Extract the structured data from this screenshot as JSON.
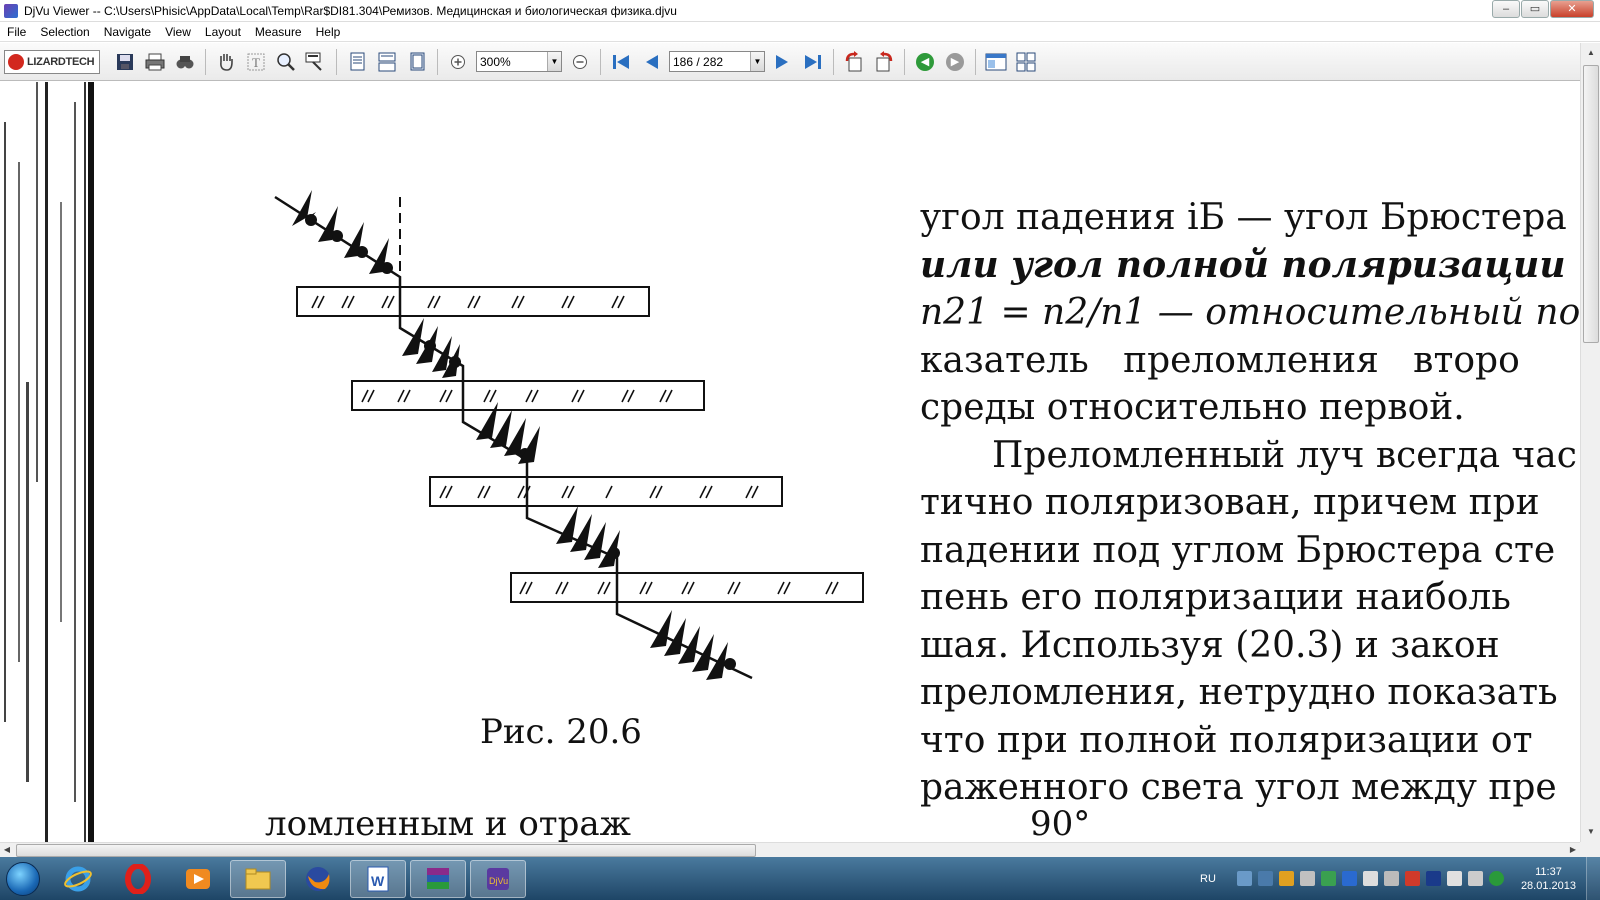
{
  "window": {
    "title": "DjVu Viewer -- C:\\Users\\Phisic\\AppData\\Local\\Temp\\Rar$DI81.304\\Ремизов. Медицинская и биологическая физика.djvu",
    "minimize": "–",
    "maximize": "▭",
    "close": "✕"
  },
  "menu": [
    "File",
    "Selection",
    "Navigate",
    "View",
    "Layout",
    "Measure",
    "Help"
  ],
  "toolbar": {
    "logo_text": "LIZARDTECH",
    "zoom_value": "300%",
    "page_value": "186 / 282",
    "icons": [
      "save-icon",
      "print-icon",
      "find-icon",
      "hand-icon",
      "text-select-icon",
      "zoom-icon",
      "marquee-zoom-icon",
      "single-page-icon",
      "continuous-icon",
      "facing-icon",
      "zoom-in-icon",
      "zoom-out-icon",
      "first-page-icon",
      "prev-page-icon",
      "next-page-icon",
      "last-page-icon",
      "rotate-left-icon",
      "rotate-right-icon",
      "back-icon",
      "forward-icon",
      "thumbnails-icon",
      "grid-icon"
    ]
  },
  "document": {
    "lines": [
      "угол падения iБ — угол Брюстера",
      "или угол полной поляризации",
      "n21 = n2/n1 — относительный по",
      "казатель   преломления   второ",
      "среды относительно первой.",
      "Преломленный луч всегда час",
      "тично поляризован, причем при",
      "падении под углом Брюстера сте",
      "пень его поляризации наиболь",
      "шая. Используя (20.3) и закон",
      "преломления, нетрудно показать",
      "что при полной поляризации от",
      "раженного света угол между пре"
    ],
    "caption": "Рис. 20.6",
    "cut_text_left": "ломленным и отраж",
    "cut_text_right": "90°"
  },
  "taskbar": {
    "lang": "RU",
    "time": "11:37",
    "date": "28.01.2013",
    "apps": [
      "ie-icon",
      "opera-icon",
      "media-player-icon",
      "explorer-icon",
      "firefox-icon",
      "word-icon",
      "winrar-icon",
      "djvu-icon"
    ]
  }
}
